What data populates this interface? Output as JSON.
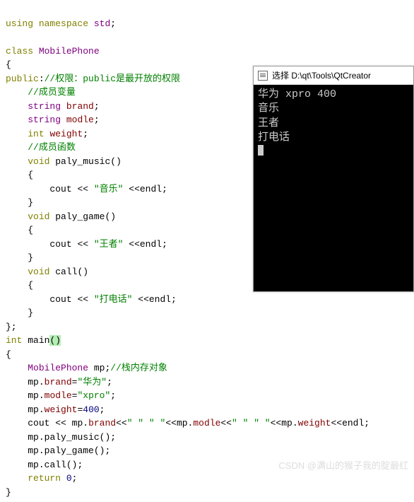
{
  "code": {
    "using": "using",
    "namespace": "namespace",
    "std": "std",
    "class": "class",
    "className": "MobilePhone",
    "public": "public",
    "comment_access": "//权限：public是最开放的权限",
    "comment_vars": "//成员变量",
    "string": "string",
    "brand": "brand",
    "modle": "modle",
    "int": "int",
    "weight": "weight",
    "comment_funcs": "//成员函数",
    "void": "void",
    "paly_music": "paly_music",
    "paly_game": "paly_game",
    "call": "call",
    "cout": "cout",
    "endl": "endl",
    "str_music": "\"音乐\"",
    "str_game": "\"王者\"",
    "str_call": "\"打电话\"",
    "main": "main",
    "comment_obj": "//栈内存对象",
    "mp": "mp",
    "str_huawei": "\"华为\"",
    "str_xpro": "\"xpro\"",
    "num_400": "400",
    "str_space": "\" \"",
    "return": "return",
    "num_0": "0"
  },
  "console": {
    "title": "选择 D:\\qt\\Tools\\QtCreator",
    "line1": "华为 xpro 400",
    "line2": "音乐",
    "line3": "王者",
    "line4": "打电话"
  },
  "watermark": "CSDN @满山的猴子我的腚最红"
}
